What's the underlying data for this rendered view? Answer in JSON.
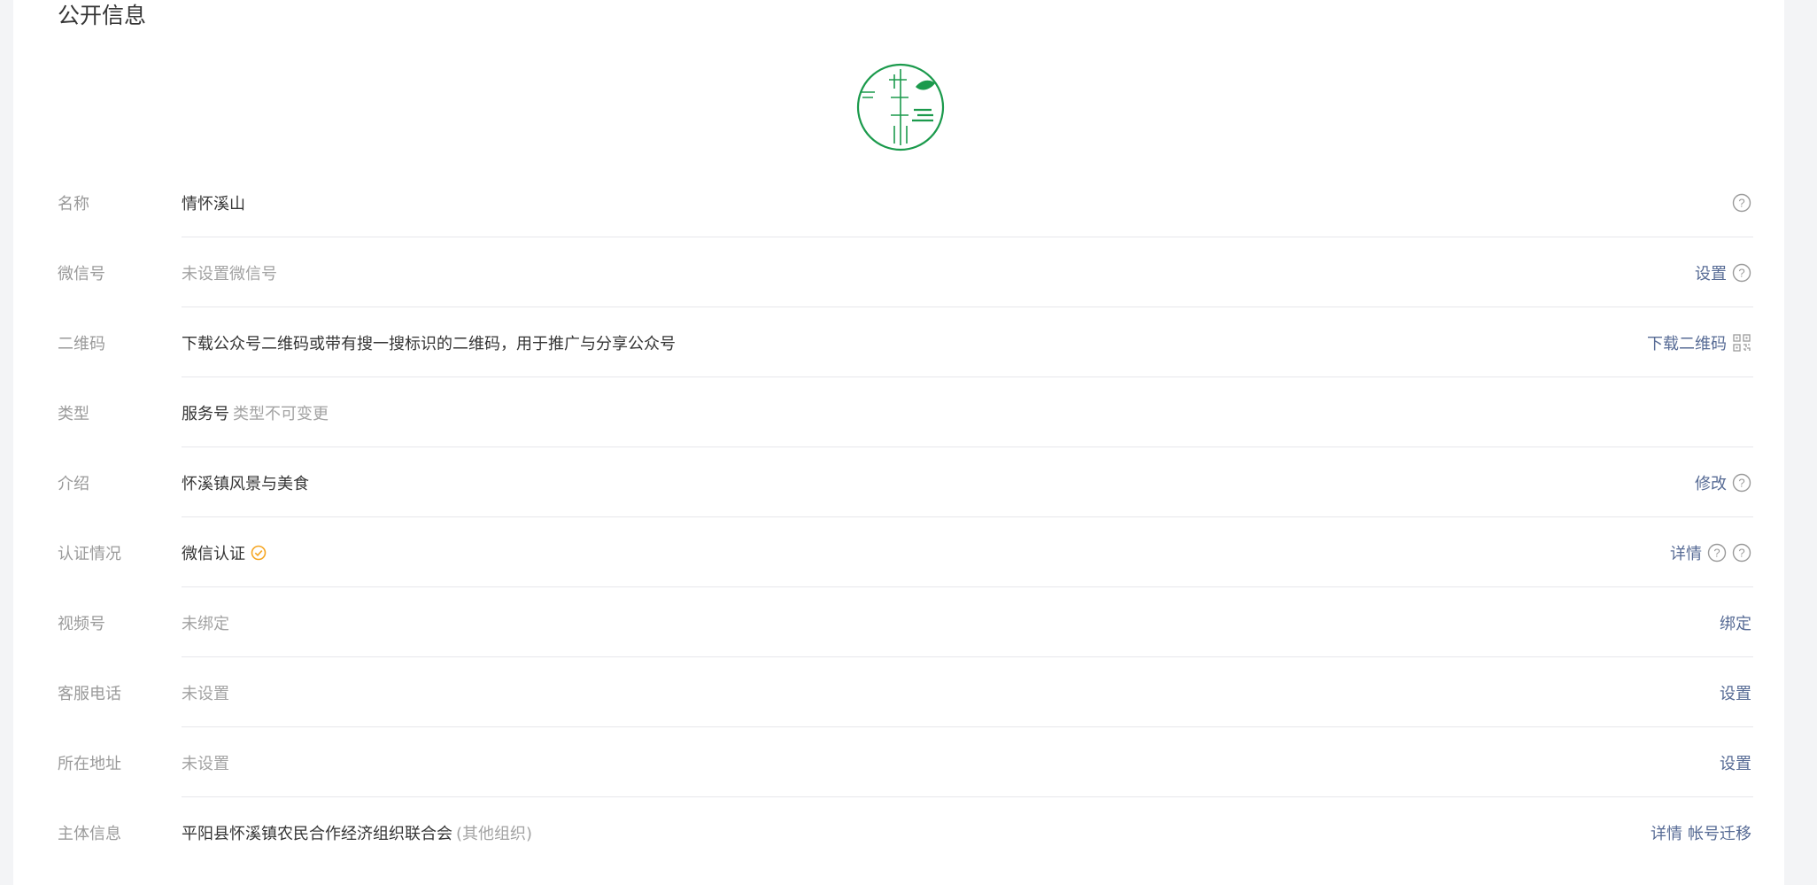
{
  "section": {
    "title": "公开信息"
  },
  "colors": {
    "accent": "#576b95",
    "logo_green": "#1b9a4c",
    "verified": "#f5a623"
  },
  "rows": [
    {
      "label": "名称",
      "value": "情怀溪山"
    },
    {
      "label": "微信号",
      "value": "未设置微信号",
      "action": "设置"
    },
    {
      "label": "二维码",
      "value": "下载公众号二维码或带有搜一搜标识的二维码，用于推广与分享公众号",
      "action": "下载二维码"
    },
    {
      "label": "类型",
      "value": "服务号",
      "note": "类型不可变更"
    },
    {
      "label": "介绍",
      "value": "怀溪镇风景与美食",
      "action": "修改"
    },
    {
      "label": "认证情况",
      "value": "微信认证",
      "action": "详情"
    },
    {
      "label": "视频号",
      "value": "未绑定",
      "action": "绑定"
    },
    {
      "label": "客服电话",
      "value": "未设置",
      "action": "设置"
    },
    {
      "label": "所在地址",
      "value": "未设置",
      "action": "设置"
    },
    {
      "label": "主体信息",
      "value": "平阳县怀溪镇农民合作经济组织联合会",
      "note": "(其他组织)",
      "action": "详情",
      "action2": "帐号迁移"
    }
  ]
}
